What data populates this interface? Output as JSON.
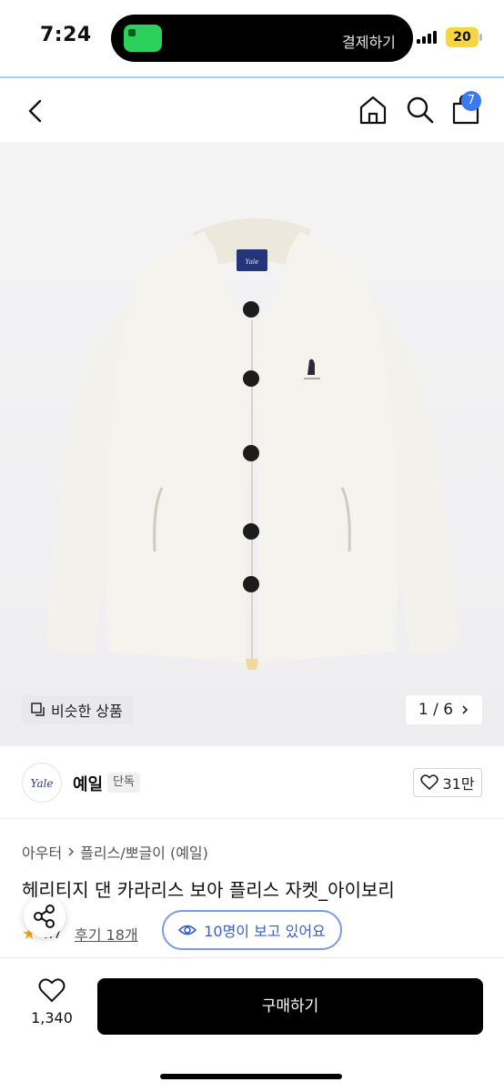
{
  "status_bar": {
    "time": "7:24",
    "island_text": "결제하기",
    "battery": "20"
  },
  "nav": {
    "cart_badge": "7"
  },
  "hero": {
    "similar_label": "비슷한 상품",
    "pager": "1 / 6"
  },
  "brand": {
    "logo_text": "Yale",
    "name": "예일",
    "tag": "단독",
    "likes": "31만"
  },
  "breadcrumb": [
    "아우터",
    "플리스/뽀글이 (예일)"
  ],
  "product": {
    "title": "헤리티지 댄 카라리스 보아 플리스 자켓_아이보리",
    "rating": "4.7",
    "reviews": "후기 18개",
    "viewers": "10명이 보고 있어요"
  },
  "bottom": {
    "wish_count": "1,340",
    "buy_label": "구매하기"
  },
  "colors": {
    "accent": "#3a7af0",
    "island_pill": "#2bd15a",
    "battery": "#f5d541",
    "star": "#f5a623",
    "viewers_border": "#7b9ce0"
  },
  "icons": [
    "back-icon",
    "home-icon",
    "search-icon",
    "shopping-bag-icon",
    "similar-items-icon",
    "chevron-right-icon",
    "heart-icon",
    "star-icon",
    "eye-icon",
    "share-icon"
  ]
}
